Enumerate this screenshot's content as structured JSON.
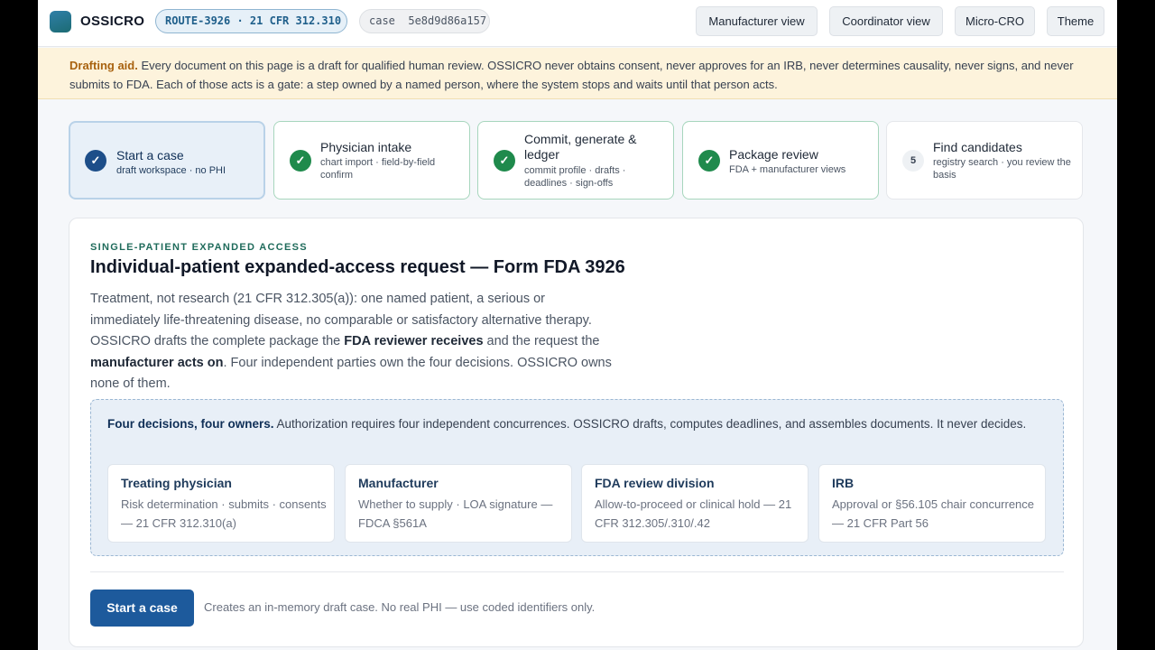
{
  "header": {
    "brand": "OSSICRO",
    "route_badge": "ROUTE-3926 · 21 CFR 312.310",
    "case_badge": "case  5e8d9d86a157",
    "nav": [
      "Manufacturer view",
      "Coordinator view",
      "Micro-CRO",
      "Theme"
    ]
  },
  "banner": {
    "lead": "Drafting aid.",
    "text": " Every document on this page is a draft for qualified human review. OSSICRO never obtains consent, never approves for an IRB, never determines causality, never signs, and never submits to FDA. Each of those acts is a gate: a step owned by a named person, where the system stops and waits until that person acts."
  },
  "steps": [
    {
      "title": "Start a case",
      "sub": "draft workspace · no PHI",
      "state": "active",
      "icon": "check-icon"
    },
    {
      "title": "Physician intake",
      "sub": "chart import · field-by-field confirm",
      "state": "done",
      "icon": "check-icon"
    },
    {
      "title": "Commit, generate & ledger",
      "sub": "commit profile · drafts · deadlines · sign-offs",
      "state": "done",
      "icon": "check-icon"
    },
    {
      "title": "Package review",
      "sub": "FDA + manufacturer views",
      "state": "done",
      "icon": "check-icon"
    },
    {
      "title": "Find candidates",
      "sub": "registry search · you review the basis",
      "state": "pending",
      "number": "5"
    }
  ],
  "main": {
    "eyebrow": "SINGLE-PATIENT EXPANDED ACCESS",
    "title": "Individual-patient expanded-access request — Form FDA 3926",
    "intro_1": "Treatment, not research (21 CFR 312.305(a)): one named patient, a serious or immediately life-threatening disease, no comparable or satisfactory alternative therapy. OSSICRO drafts the complete package the ",
    "intro_b1": "FDA reviewer receives",
    "intro_2": " and the request the ",
    "intro_b2": "manufacturer acts on",
    "intro_3": ". Four independent parties own the four decisions. OSSICRO owns none of them.",
    "decisions_lead": "Four decisions, four owners.",
    "decisions_text": " Authorization requires four independent concurrences. OSSICRO drafts, computes deadlines, and assembles documents. It never decides.",
    "owners": [
      {
        "title": "Treating physician",
        "text": "Risk determination · submits · consents — 21 CFR 312.310(a)"
      },
      {
        "title": "Manufacturer",
        "text": "Whether to supply · LOA signature — FDCA §561A"
      },
      {
        "title": "FDA review division",
        "text": "Allow-to-proceed or clinical hold — 21 CFR 312.305/.310/.42"
      },
      {
        "title": "IRB",
        "text": "Approval or §56.105 chair concurrence — 21 CFR Part 56"
      }
    ],
    "start_button": "Start a case",
    "start_hint": "Creates an in-memory draft case. No real PHI — use coded identifiers only."
  }
}
